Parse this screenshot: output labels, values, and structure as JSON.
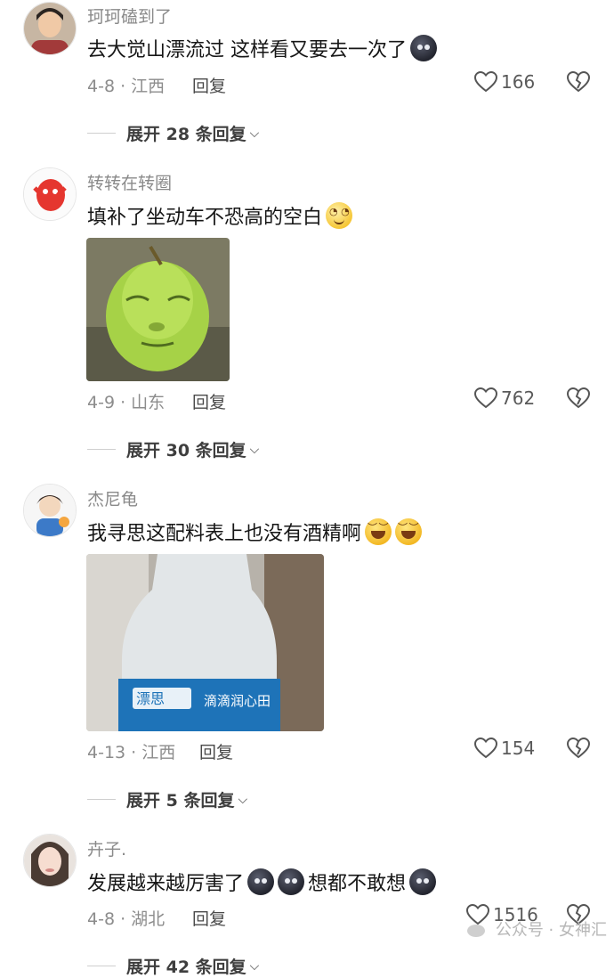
{
  "comments": [
    {
      "username": "珂珂磕到了",
      "text": "去大觉山漂流过 这样看又要去一次了",
      "date_location": "4-8 · 江西",
      "reply_label": "回复",
      "likes": "166",
      "expand_label": "展开 28 条回复",
      "emojis": [
        "dark-moon-icon"
      ]
    },
    {
      "username": "转转在转圈",
      "text": "填补了坐动车不恐高的空白",
      "date_location": "4-9 · 山东",
      "reply_label": "回复",
      "likes": "762",
      "expand_label": "展开 30 条回复",
      "emojis": [
        "smile-emoji-icon"
      ],
      "image": "green-pear-face-meme"
    },
    {
      "username": "杰尼龟",
      "text": "我寻思这配料表上也没有酒精啊",
      "date_location": "4-13 · 江西",
      "reply_label": "回复",
      "likes": "154",
      "expand_label": "展开 5 条回复",
      "emojis": [
        "grin-emoji-icon",
        "grin-emoji-icon"
      ],
      "image": "water-bottle-photo",
      "image_label": "滴滴润心田"
    },
    {
      "username": "卉子.",
      "text_before": "发展越来越厉害了",
      "text_after": "想都不敢想",
      "date_location": "4-8 · 湖北",
      "reply_label": "回复",
      "likes": "1516",
      "expand_label": "展开 42 条回复",
      "emojis": [
        "dark-moon-icon",
        "dark-moon-icon",
        "dark-moon-icon"
      ]
    }
  ],
  "watermark": "公众号 · 女神汇"
}
